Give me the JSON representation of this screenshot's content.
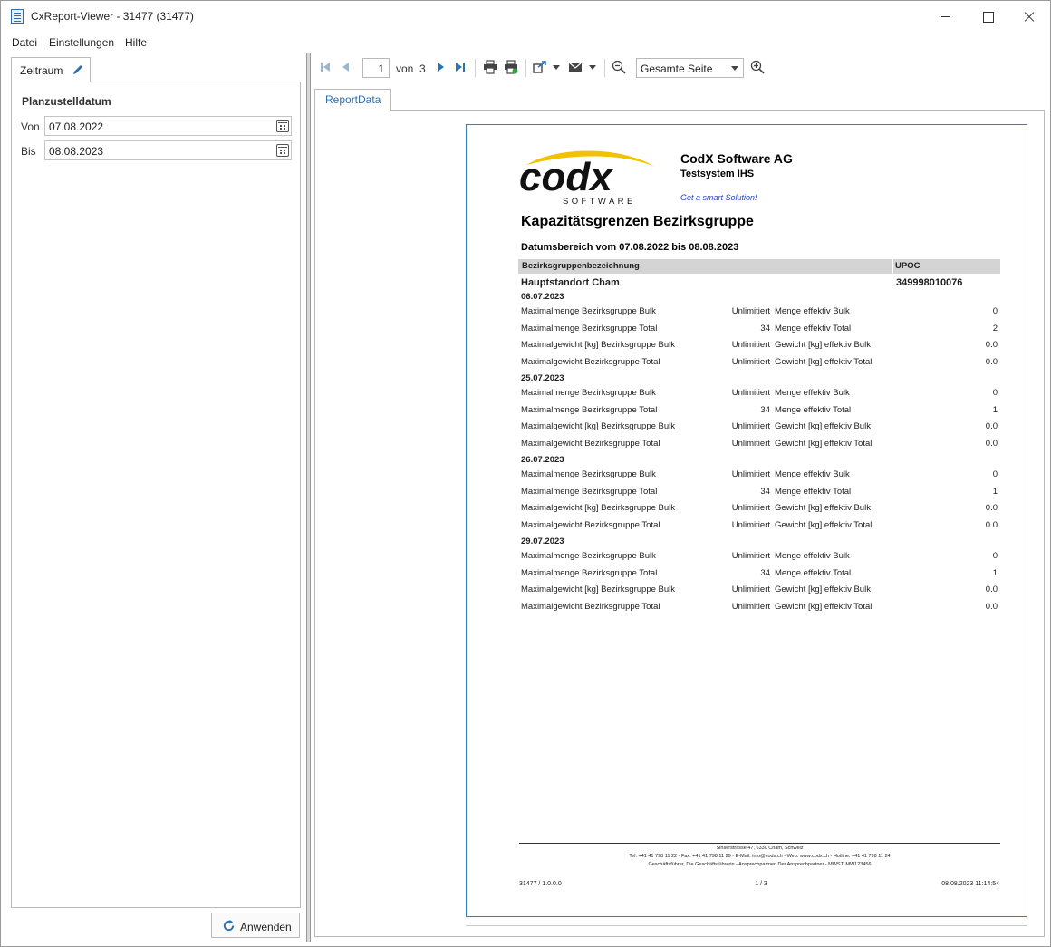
{
  "window": {
    "title": "CxReport-Viewer - 31477 (31477)"
  },
  "menu": [
    "Datei",
    "Einstellungen",
    "Hilfe"
  ],
  "left_panel": {
    "tab_label": "Zeitraum",
    "section_title": "Planzustelldatum",
    "from_label": "Von",
    "from_value": "07.08.2022",
    "to_label": "Bis",
    "to_value": "08.08.2023",
    "apply_label": "Anwenden"
  },
  "toolbar": {
    "page_current": "1",
    "page_of": "von",
    "page_total": "3",
    "zoom_value": "Gesamte Seite",
    "icons": [
      "first-page-icon",
      "prev-page-icon",
      "next-page-icon",
      "last-page-icon",
      "print-icon",
      "quick-print-icon",
      "export-icon",
      "email-icon",
      "zoom-out-icon",
      "zoom-in-icon"
    ]
  },
  "report_tab": {
    "label": "ReportData"
  },
  "report": {
    "logo_text": "codx",
    "logo_subtext": "SOFTWARE",
    "company": "CodX Software AG",
    "system": "Testsystem IHS",
    "slogan": "Get a smart Solution!",
    "title": "Kapazitätsgrenzen Bezirksgruppe",
    "date_range": "Datumsbereich vom 07.08.2022 bis 08.08.2023",
    "header_col1": "Bezirksgruppenbezeichnung",
    "header_col2": "UPOC",
    "group_name": "Hauptstandort Cham",
    "group_code": "349998010076",
    "sections": [
      {
        "date": "06.07.2023",
        "rows": [
          [
            "Maximalmenge Bezirksgruppe Bulk",
            "Unlimitiert",
            "Menge effektiv Bulk",
            "0"
          ],
          [
            "Maximalmenge Bezirksgruppe Total",
            "34",
            "Menge effektiv Total",
            "2"
          ],
          [
            "Maximalgewicht [kg] Bezirksgruppe Bulk",
            "Unlimitiert",
            "Gewicht [kg] effektiv Bulk",
            "0.0"
          ],
          [
            "Maximalgewicht Bezirksgruppe Total",
            "Unlimitiert",
            "Gewicht [kg] effektiv Total",
            "0.0"
          ]
        ]
      },
      {
        "date": "25.07.2023",
        "rows": [
          [
            "Maximalmenge Bezirksgruppe Bulk",
            "Unlimitiert",
            "Menge effektiv Bulk",
            "0"
          ],
          [
            "Maximalmenge Bezirksgruppe Total",
            "34",
            "Menge effektiv Total",
            "1"
          ],
          [
            "Maximalgewicht [kg] Bezirksgruppe Bulk",
            "Unlimitiert",
            "Gewicht [kg] effektiv Bulk",
            "0.0"
          ],
          [
            "Maximalgewicht Bezirksgruppe Total",
            "Unlimitiert",
            "Gewicht [kg] effektiv Total",
            "0.0"
          ]
        ]
      },
      {
        "date": "26.07.2023",
        "rows": [
          [
            "Maximalmenge Bezirksgruppe Bulk",
            "Unlimitiert",
            "Menge effektiv Bulk",
            "0"
          ],
          [
            "Maximalmenge Bezirksgruppe Total",
            "34",
            "Menge effektiv Total",
            "1"
          ],
          [
            "Maximalgewicht [kg] Bezirksgruppe Bulk",
            "Unlimitiert",
            "Gewicht [kg] effektiv Bulk",
            "0.0"
          ],
          [
            "Maximalgewicht Bezirksgruppe Total",
            "Unlimitiert",
            "Gewicht [kg] effektiv Total",
            "0.0"
          ]
        ]
      },
      {
        "date": "29.07.2023",
        "rows": [
          [
            "Maximalmenge Bezirksgruppe Bulk",
            "Unlimitiert",
            "Menge effektiv Bulk",
            "0"
          ],
          [
            "Maximalmenge Bezirksgruppe Total",
            "34",
            "Menge effektiv Total",
            "1"
          ],
          [
            "Maximalgewicht [kg] Bezirksgruppe Bulk",
            "Unlimitiert",
            "Gewicht [kg] effektiv Bulk",
            "0.0"
          ],
          [
            "Maximalgewicht Bezirksgruppe Total",
            "Unlimitiert",
            "Gewicht [kg] effektiv Total",
            "0.0"
          ]
        ]
      }
    ],
    "footer": {
      "line1": "Sinserstrasse 47, 6330 Cham, Schweiz",
      "line2": "Tel. +41 41 798 11 22 - Fax. +41 41 798 11 29 - E-Mail. info@codx.ch - Web. www.codx.ch - Hotline. +41 41 798 11 24",
      "line3": "Geschäftsführer, Die Geschäftsführerin - Ansprechpartner, Der Ansprechpartner - MWST. MW123456",
      "left": "31477 / 1.0.0.0",
      "center": "1 / 3",
      "right": "08.08.2023 11:14:54"
    }
  },
  "colors": {
    "accent": "#2b6fb5",
    "logo_yellow": "#f2c100",
    "slogan_blue": "#1d3fbf"
  }
}
